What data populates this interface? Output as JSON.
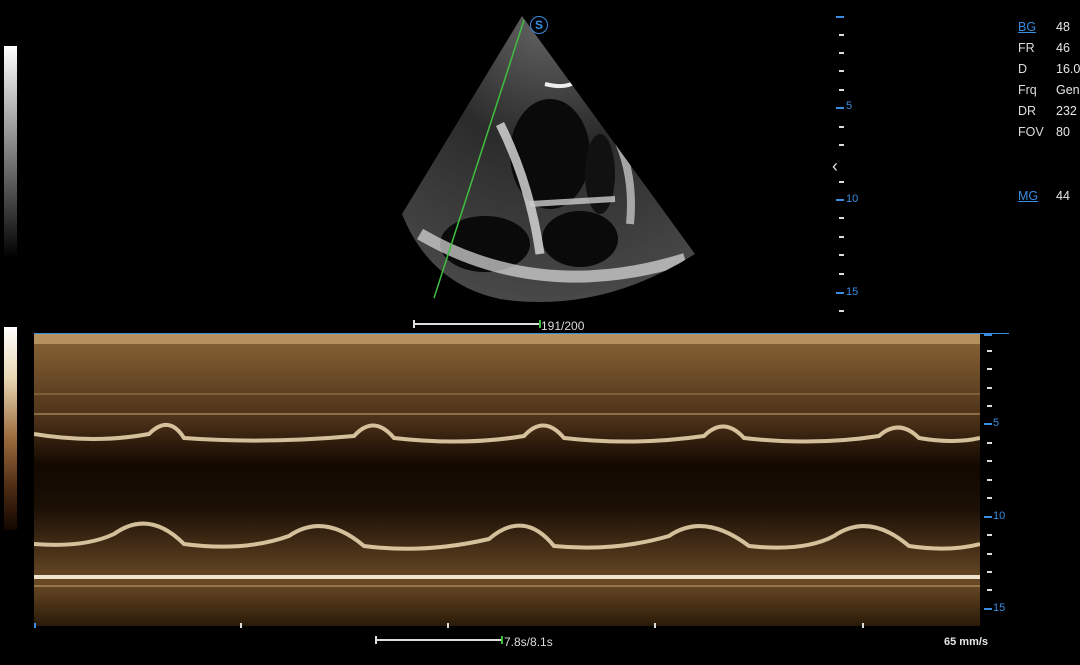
{
  "params": [
    {
      "key": "BG",
      "value": "48",
      "link": true
    },
    {
      "key": "FR",
      "value": "46",
      "link": false
    },
    {
      "key": "D",
      "value": "16.0",
      "link": false
    },
    {
      "key": "Frq",
      "value": "Gen",
      "link": false
    },
    {
      "key": "DR",
      "value": "232",
      "link": false
    },
    {
      "key": "FOV",
      "value": "80",
      "link": false
    },
    {
      "key": "MG",
      "value": "44",
      "link": true
    }
  ],
  "badge": {
    "letter": "S"
  },
  "bmode_depth_labels": [
    "5",
    "10",
    "15"
  ],
  "mmode_depth_labels": [
    "5",
    "10",
    "15"
  ],
  "bmode_measure_text": "191/200",
  "mmode_measure_text": "7.8s/8.1s",
  "sweep_speed": "65 mm/s",
  "colors": {
    "accent": "#3a8de0",
    "m_line": "#3fbf3f",
    "mmode_tint": "#c8a46a"
  }
}
